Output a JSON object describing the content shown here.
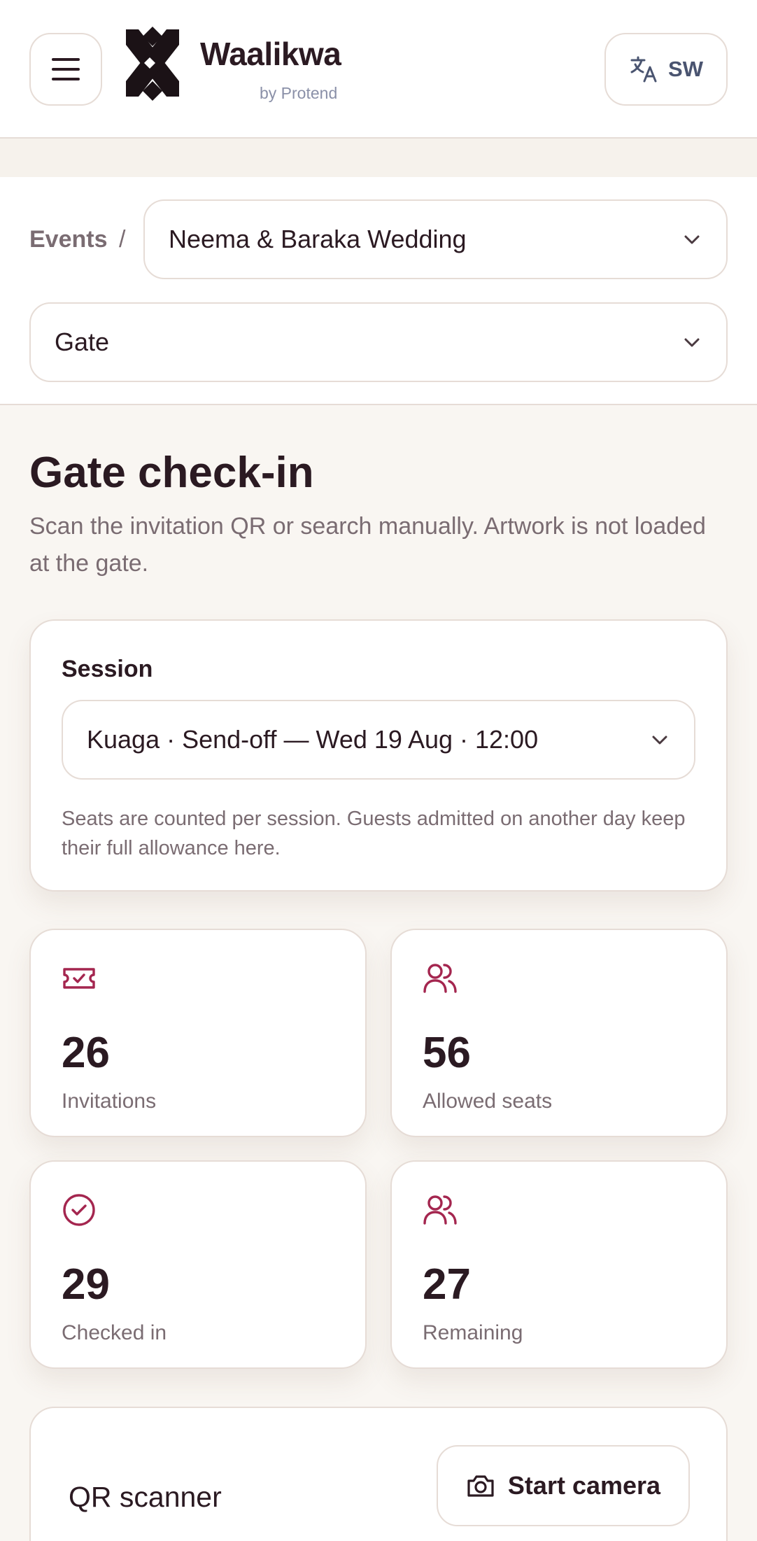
{
  "header": {
    "brand_title": "Waalikwa",
    "brand_subtitle": "by Protend",
    "language_code": "SW"
  },
  "breadcrumb": {
    "events_label": "Events",
    "separator": "/"
  },
  "event_select": {
    "value": "Neema & Baraka Wedding"
  },
  "role_select": {
    "value": "Gate"
  },
  "page": {
    "title": "Gate check-in",
    "subtitle": "Scan the invitation QR or search manually. Artwork is not loaded at the gate."
  },
  "session": {
    "label": "Session",
    "value": "Kuaga · Send-off — Wed 19 Aug · 12:00",
    "help": "Seats are counted per session. Guests admitted on another day keep their full allowance here."
  },
  "stats": [
    {
      "value": "26",
      "label": "Invitations",
      "icon": "ticket-check-icon"
    },
    {
      "value": "56",
      "label": "Allowed seats",
      "icon": "users-icon"
    },
    {
      "value": "29",
      "label": "Checked in",
      "icon": "check-circle-icon"
    },
    {
      "value": "27",
      "label": "Remaining",
      "icon": "users-icon"
    }
  ],
  "scanner": {
    "title": "QR scanner",
    "camera_button": "Start camera"
  },
  "colors": {
    "accent": "#a4264f",
    "background": "#f9f6f2",
    "border": "#e6dcd6",
    "text": "#2b1a22",
    "muted": "#7a6c72"
  }
}
